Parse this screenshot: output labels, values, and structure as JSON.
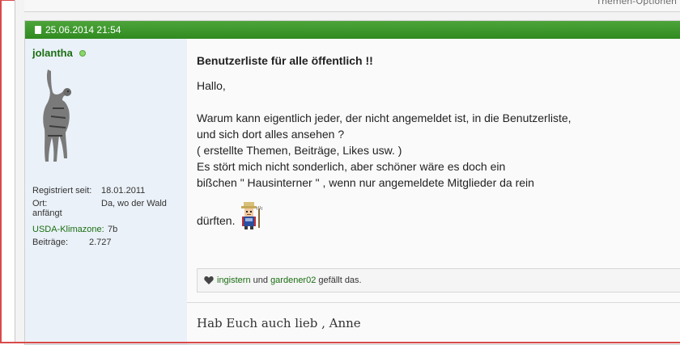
{
  "top_bar": {
    "thread_options": "Themen-Optionen"
  },
  "post": {
    "date": "25.06.2014 21:54",
    "author": {
      "name": "jolantha",
      "info": [
        {
          "label": "Registriert seit:",
          "value": "18.01.2011"
        },
        {
          "label": "Ort:",
          "value": "Da, wo der Wald anfängt"
        },
        {
          "label": "USDA-Klimazone:",
          "value": "7b"
        },
        {
          "label": "Beiträge:",
          "value": "2.727"
        }
      ]
    },
    "title": "Benutzerliste für alle öffentlich !!",
    "body": {
      "greeting": "Hallo,",
      "line1": "Warum kann eigentlich jeder, der nicht angemeldet ist, in die Benutzerliste,",
      "line2": "und sich dort alles ansehen ?",
      "line3": "( erstellte Themen, Beiträge, Likes usw. )",
      "line4": "Es stört mich nicht sonderlich, aber schöner wäre es doch ein",
      "line5": "bißchen \" Hausinterner \" , wenn nur angemeldete Mitglieder da rein",
      "line6": "dürften."
    },
    "likes": {
      "user1": "ingistern",
      "connector": "und",
      "user2": "gardener02",
      "suffix": "gefällt das."
    },
    "signature": "Hab Euch auch lieb , Anne"
  },
  "icons": {
    "post_icon": "document-icon",
    "online": "online-status-icon",
    "like": "heart-icon",
    "emoji": "gardener-smiley-icon"
  },
  "colors": {
    "header_green": "#3a9a2a",
    "link_green": "#1a6e12",
    "sidebar_bg": "#eaf1f8"
  }
}
